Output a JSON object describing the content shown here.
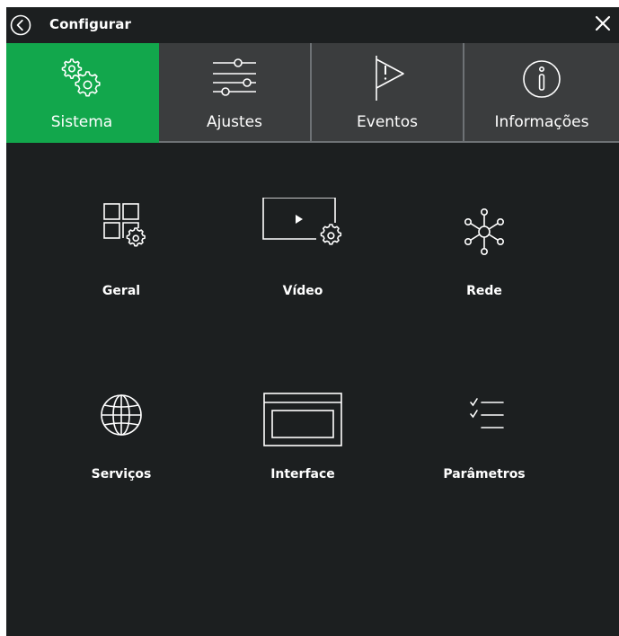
{
  "header": {
    "title": "Configurar"
  },
  "tabs": [
    {
      "label": "Sistema",
      "icon": "gears-icon",
      "active": true
    },
    {
      "label": "Ajustes",
      "icon": "sliders-icon",
      "active": false
    },
    {
      "label": "Eventos",
      "icon": "flag-alert-icon",
      "active": false
    },
    {
      "label": "Informações",
      "icon": "info-icon",
      "active": false
    }
  ],
  "items": [
    {
      "label": "Geral",
      "icon": "grid-gear-icon"
    },
    {
      "label": "Vídeo",
      "icon": "video-gear-icon"
    },
    {
      "label": "Rede",
      "icon": "network-icon"
    },
    {
      "label": "Serviços",
      "icon": "globe-icon"
    },
    {
      "label": "Interface",
      "icon": "window-icon"
    },
    {
      "label": "Parâmetros",
      "icon": "checklist-icon"
    }
  ],
  "colors": {
    "accent": "#12a74c",
    "background": "#1c1f20",
    "tab_inactive": "#3b3d3e",
    "tab_border": "#6e7275",
    "text": "#ffffff"
  }
}
